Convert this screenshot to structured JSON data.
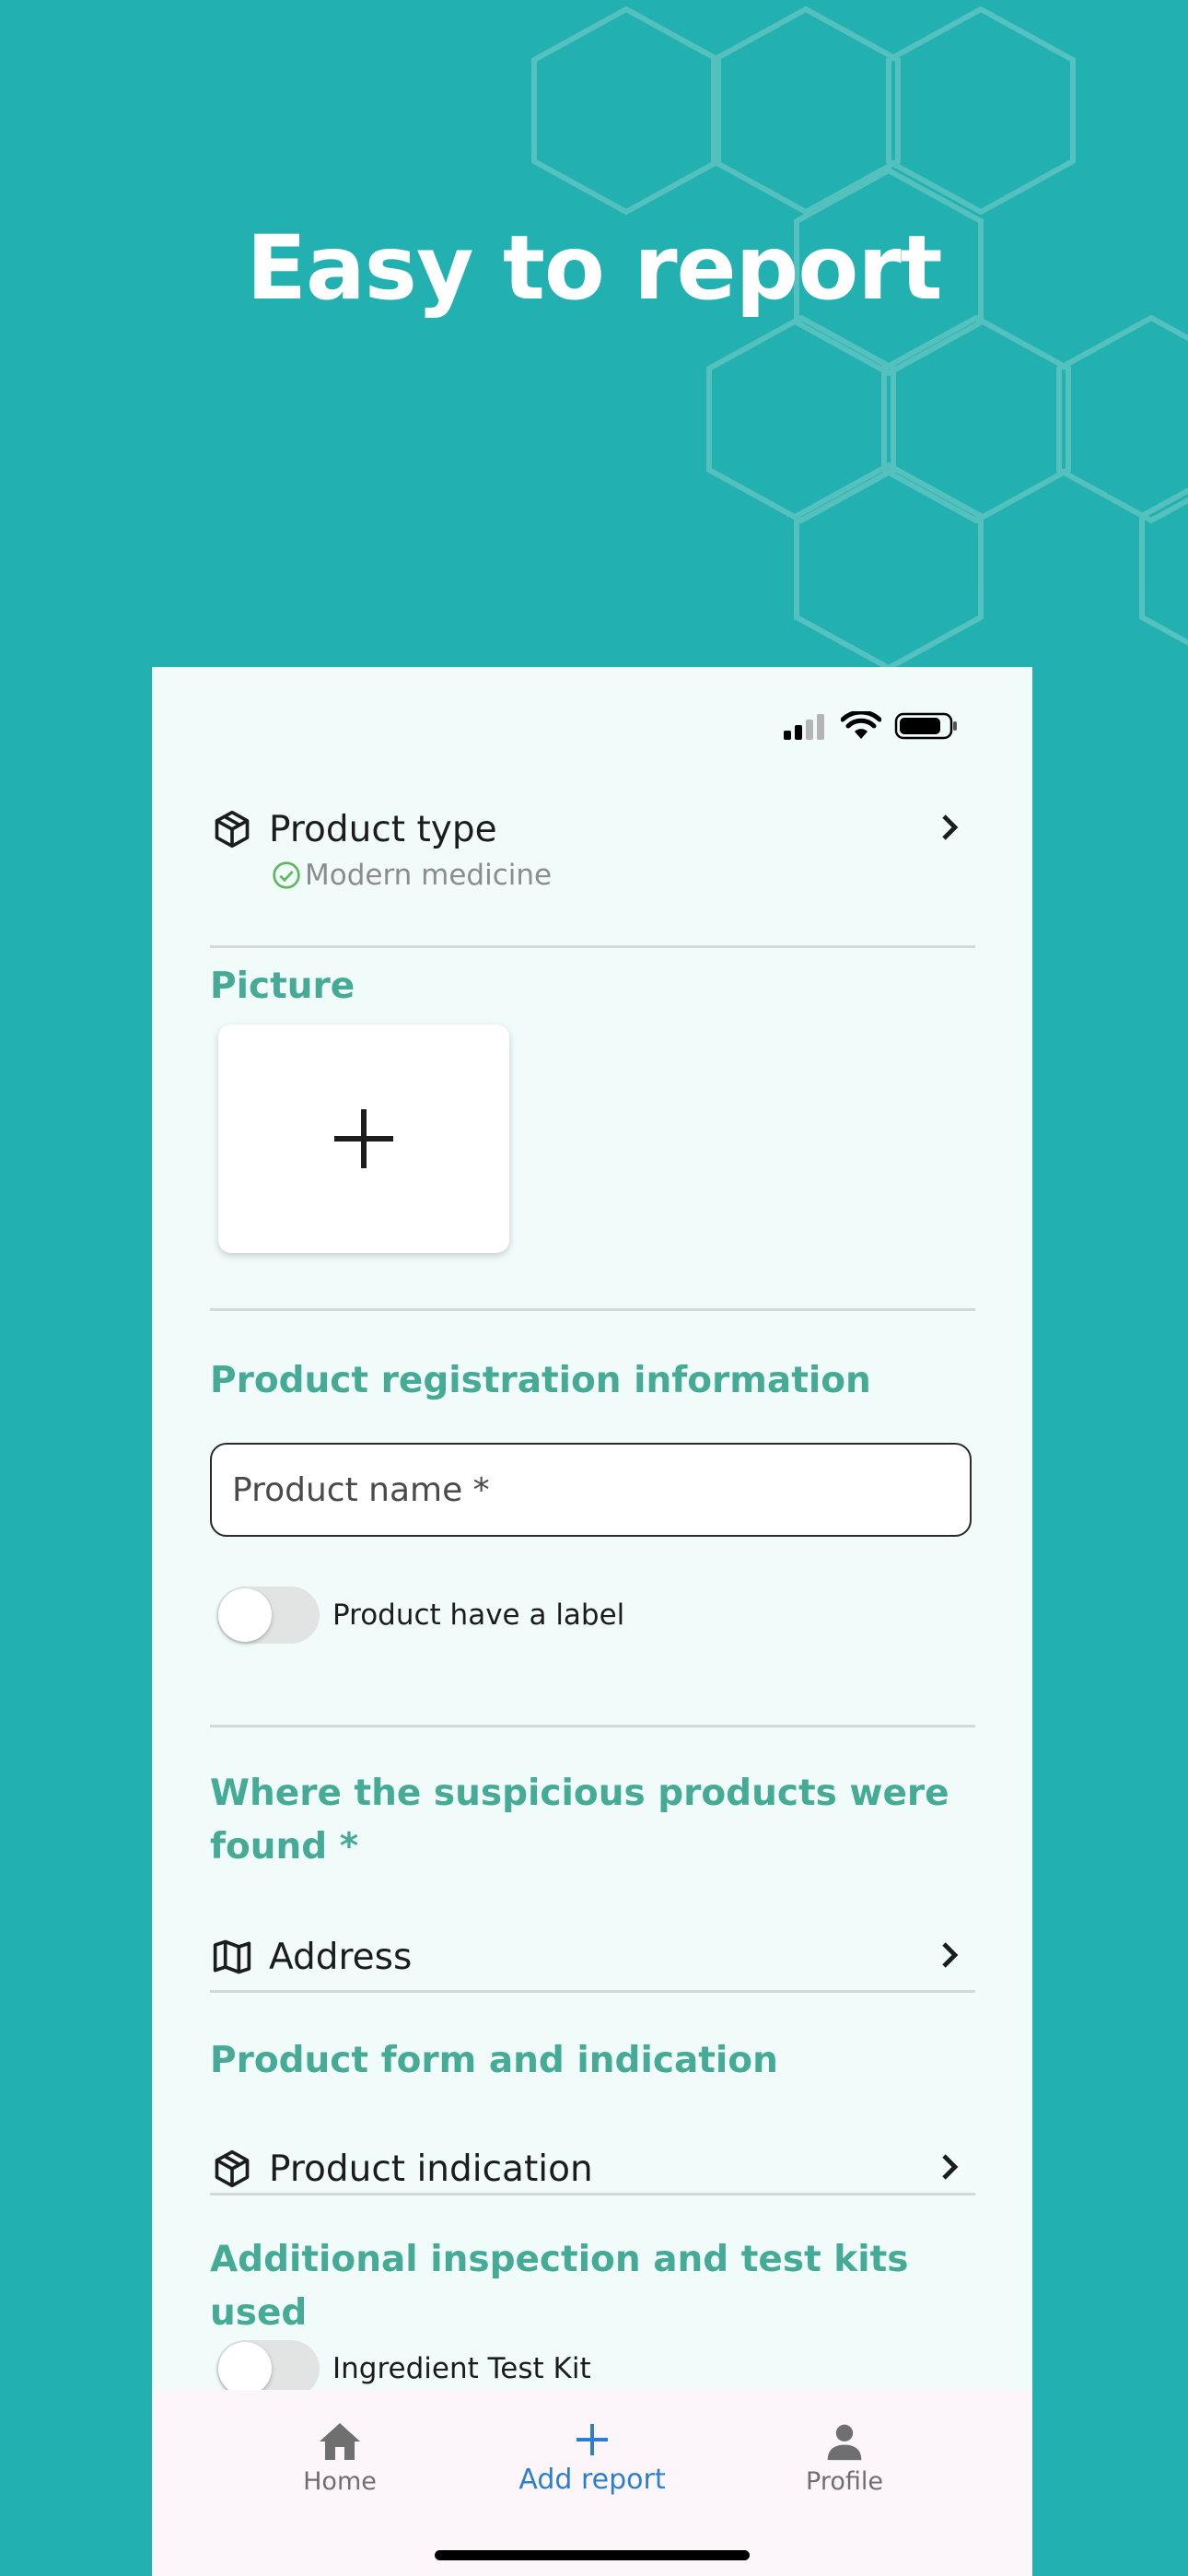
{
  "headline": "Easy to report",
  "colors": {
    "background": "#23b0b1",
    "card": "#f1fbfa",
    "section_heading": "#46ab96",
    "active_nav": "#2d7ed0",
    "success_check": "#5cb85c"
  },
  "status_bar": {
    "icons": [
      "cellular-signal-icon",
      "wifi-icon",
      "battery-icon"
    ]
  },
  "product_type": {
    "icon": "package-icon",
    "label": "Product type",
    "value": "Modern medicine",
    "value_icon": "check-circle-icon"
  },
  "picture": {
    "heading": "Picture",
    "add_icon": "plus-icon"
  },
  "registration": {
    "heading": "Product registration information",
    "name_placeholder": "Product name *",
    "label_toggle": "Product have a label",
    "label_toggle_on": false
  },
  "location": {
    "heading": "Where the suspicious products were found *",
    "address_icon": "map-icon",
    "address_label": "Address"
  },
  "form_indication": {
    "heading": "Product form and indication",
    "icon": "package-icon",
    "label": "Product indication"
  },
  "test_kits": {
    "heading": "Additional inspection and test kits used",
    "kit_label": "Ingredient Test Kit",
    "kit_on": false
  },
  "bottom_nav": {
    "items": [
      {
        "label": "Home",
        "icon": "home-icon",
        "active": false
      },
      {
        "label": "Add report",
        "icon": "plus-icon",
        "active": true
      },
      {
        "label": "Profile",
        "icon": "person-icon",
        "active": false
      }
    ]
  }
}
